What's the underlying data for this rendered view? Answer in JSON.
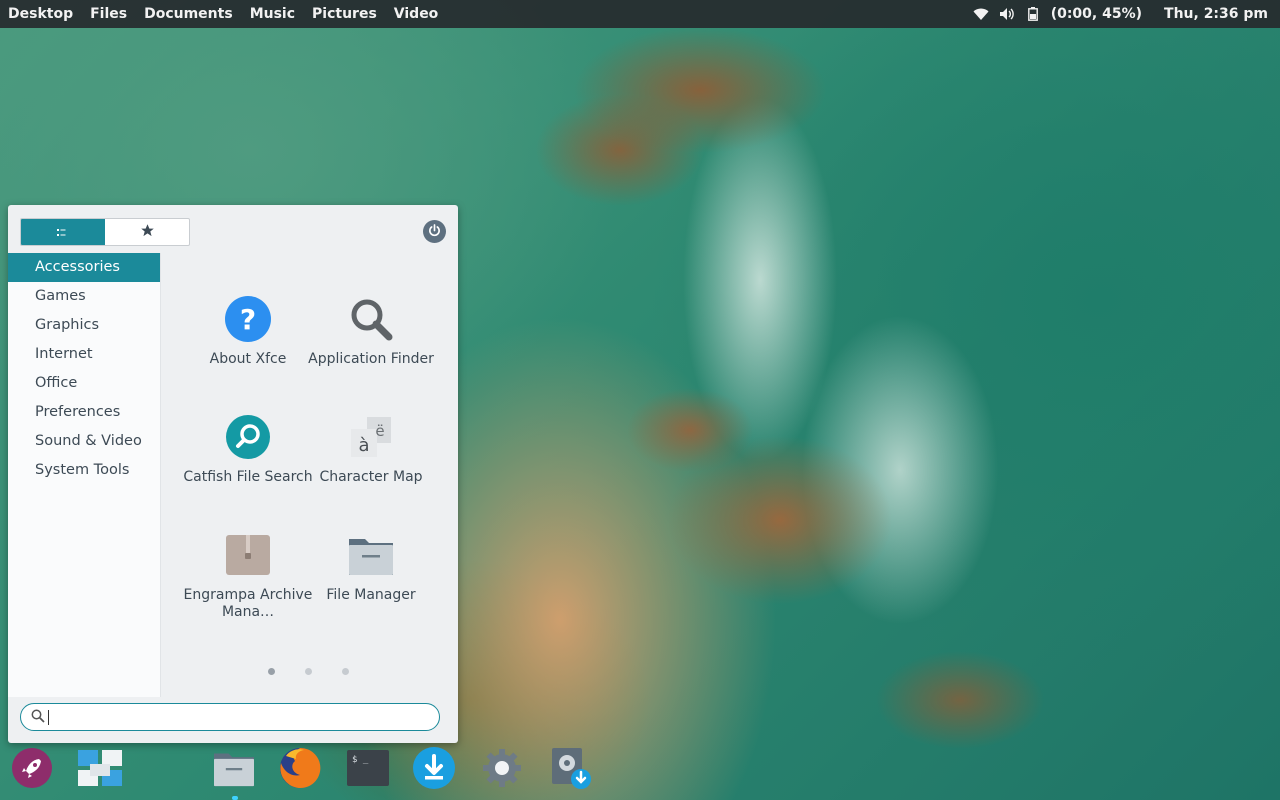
{
  "top_panel": {
    "places": [
      "Desktop",
      "Files",
      "Documents",
      "Music",
      "Pictures",
      "Video"
    ],
    "battery_status": "(0:00, 45%)",
    "clock": "Thu,  2:36 pm",
    "icons": [
      "wifi-icon",
      "volume-icon",
      "battery-icon"
    ]
  },
  "menu": {
    "view_toggle": [
      "list-view-icon",
      "favorites-star-icon"
    ],
    "power_icon": "power-icon",
    "categories": [
      {
        "label": "Accessories",
        "active": true
      },
      {
        "label": "Games"
      },
      {
        "label": "Graphics"
      },
      {
        "label": "Internet"
      },
      {
        "label": "Office"
      },
      {
        "label": "Preferences"
      },
      {
        "label": "Sound & Video"
      },
      {
        "label": "System Tools"
      }
    ],
    "apps": [
      {
        "label": "About Xfce",
        "icon": "help-icon"
      },
      {
        "label": "Application Finder",
        "icon": "magnifier-icon"
      },
      {
        "label": "Catfish File Search",
        "icon": "catfish-search-icon"
      },
      {
        "label": "Character Map",
        "icon": "character-map-icon"
      },
      {
        "label": "Engrampa Archive Mana…",
        "icon": "archive-icon"
      },
      {
        "label": "File Manager",
        "icon": "folder-icon"
      }
    ],
    "pages": 3,
    "current_page": 1,
    "search": {
      "value": "",
      "placeholder": ""
    }
  },
  "dock": {
    "items": [
      "launcher-rocket-icon",
      "workspaces-icon",
      "files-folder-icon",
      "firefox-icon",
      "terminal-icon",
      "download-icon",
      "settings-gear-icon",
      "disk-install-icon"
    ]
  },
  "colors": {
    "accent": "#1b8a9a",
    "panel": "#26292d",
    "menu_bg": "#eef0f2"
  }
}
